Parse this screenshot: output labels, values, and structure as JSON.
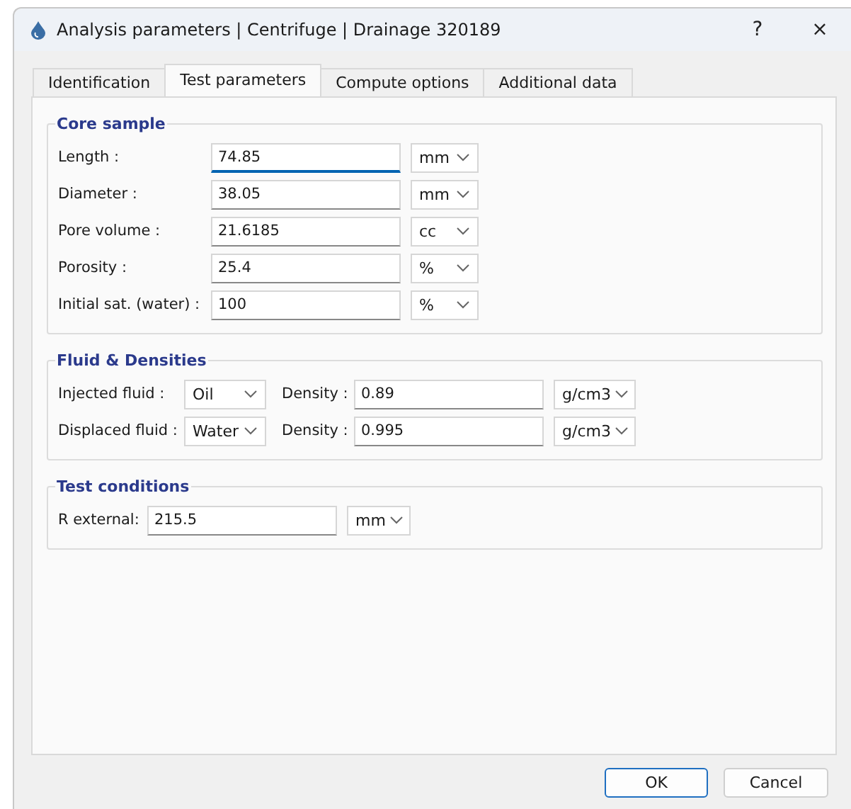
{
  "window": {
    "title": "Analysis parameters | Centrifuge | Drainage 320189",
    "help": "?",
    "close": "×"
  },
  "tabs": [
    {
      "label": "Identification",
      "selected": false
    },
    {
      "label": "Test parameters",
      "selected": true
    },
    {
      "label": "Compute options",
      "selected": false
    },
    {
      "label": "Additional data",
      "selected": false
    }
  ],
  "core_sample": {
    "title": "Core sample",
    "rows": [
      {
        "label": "Length :",
        "value": "74.85",
        "unit": "mm",
        "focused": true
      },
      {
        "label": "Diameter :",
        "value": "38.05",
        "unit": "mm",
        "focused": false
      },
      {
        "label": "Pore volume :",
        "value": "21.6185",
        "unit": "cc",
        "focused": false
      },
      {
        "label": "Porosity :",
        "value": "25.4",
        "unit": "%",
        "focused": false
      },
      {
        "label": "Initial sat. (water) :",
        "value": "100",
        "unit": "%",
        "focused": false
      }
    ]
  },
  "fluid_densities": {
    "title": "Fluid & Densities",
    "rows": [
      {
        "label": "Injected fluid :",
        "fluid": "Oil",
        "density_label": "Density :",
        "density": "0.89",
        "unit": "g/cm3"
      },
      {
        "label": "Displaced fluid :",
        "fluid": "Water",
        "density_label": "Density :",
        "density": "0.995",
        "unit": "g/cm3"
      }
    ]
  },
  "test_conditions": {
    "title": "Test conditions",
    "label": "R external:",
    "value": "215.5",
    "unit": "mm"
  },
  "buttons": [
    {
      "label": "OK",
      "default": true
    },
    {
      "label": "Cancel",
      "default": false
    }
  ]
}
